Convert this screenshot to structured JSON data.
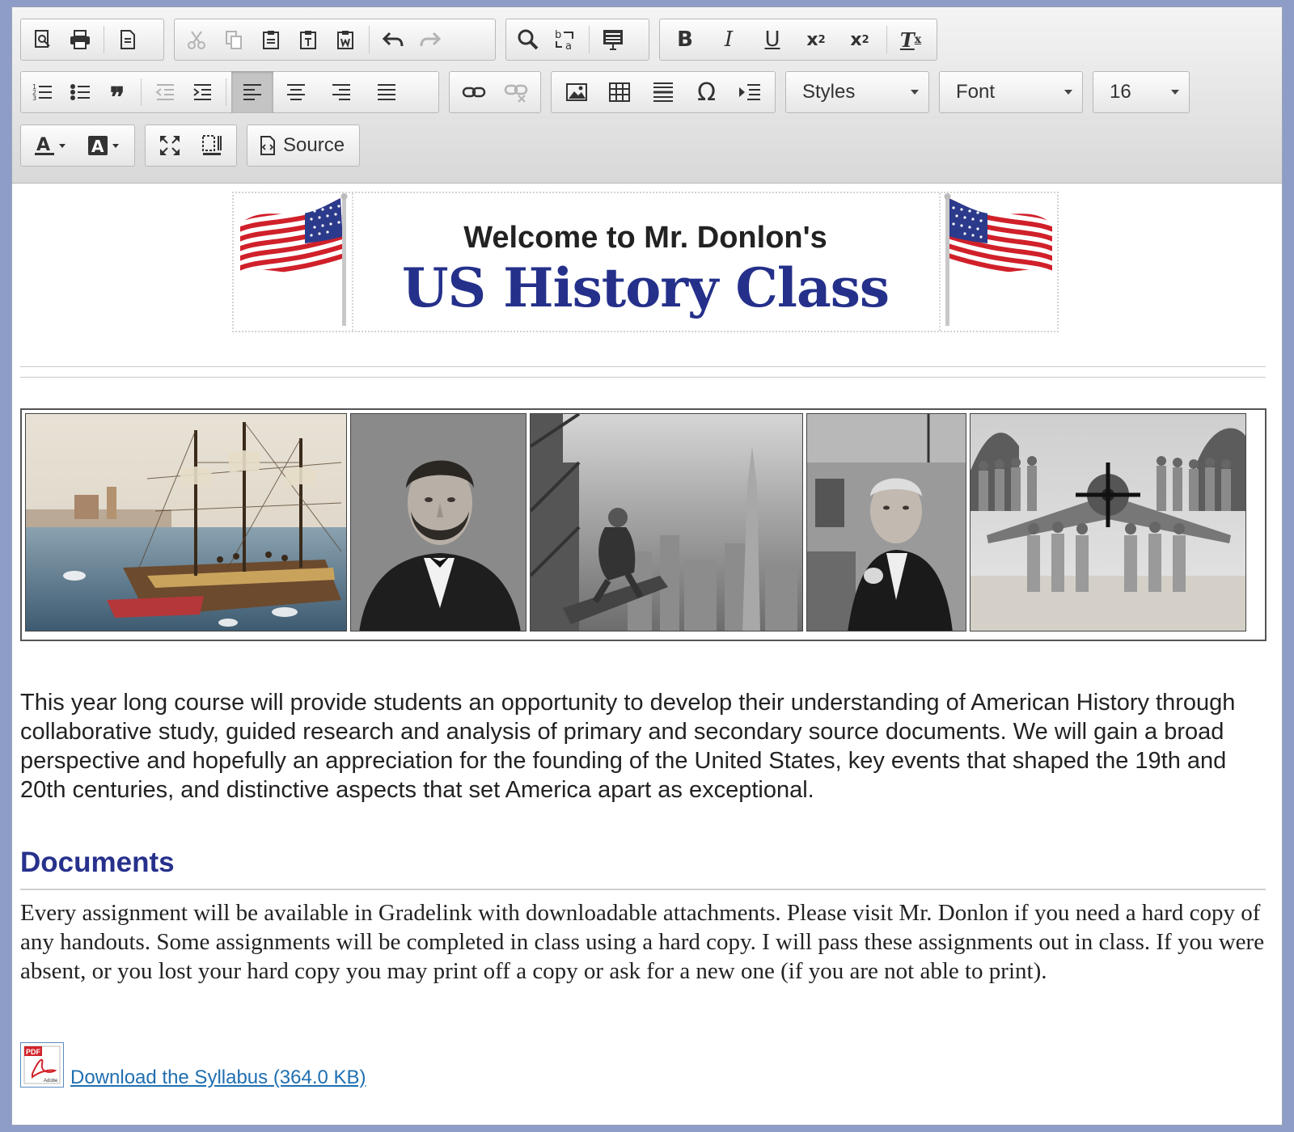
{
  "toolbar": {
    "styles_label": "Styles",
    "font_label": "Font",
    "size_value": "16",
    "source_label": "Source"
  },
  "banner": {
    "line1": "Welcome to Mr. Donlon's",
    "line2": "US History Class"
  },
  "intro": "This year long course will provide students an opportunity to develop their understanding of American History through collaborative study, guided research and analysis of primary and secondary source documents. We will gain a broad perspective and hopefully an appreciation for the founding of the United States, key events that shaped the 19th and 20th centuries, and distinctive aspects that set America apart as exceptional.",
  "documents": {
    "title": "Documents",
    "text": "Every assignment will be available in Gradelink with downloadable attachments. Please visit Mr. Donlon if you need a hard copy of any handouts. Some assignments will be completed in class using a hard copy. I will pass these assignments out in class. If you were absent, or you lost your hard copy you may print off a copy or ask for a new one (if you are not able to print).",
    "download_label": "Download the Syllabus (364.0 KB)",
    "pdf_badge": "PDF",
    "pdf_brand": "Adobe"
  },
  "colors": {
    "heading": "#27318c",
    "banner_title": "#24308a",
    "link": "#1f6fb1"
  }
}
